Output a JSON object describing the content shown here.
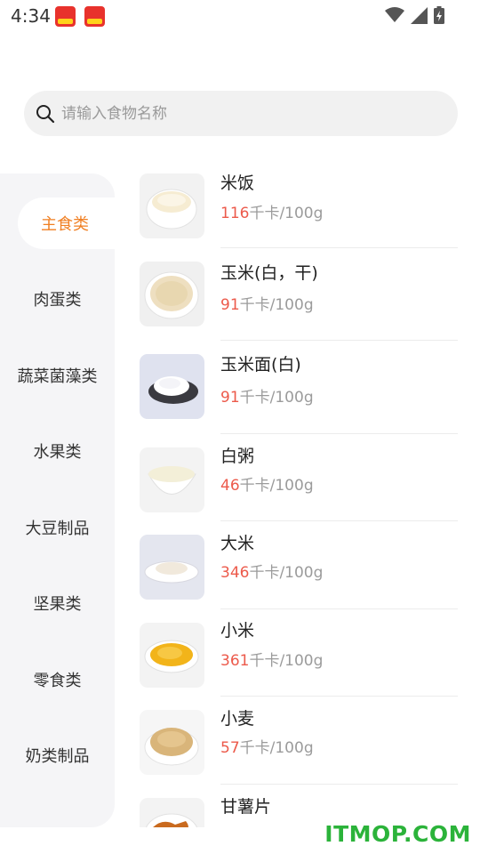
{
  "status_bar": {
    "time": "4:34",
    "icons": [
      "app-badge-icon",
      "app-badge-icon",
      "wifi-icon",
      "signal-icon",
      "battery-charging-icon"
    ]
  },
  "search": {
    "placeholder": "请输入食物名称",
    "icon": "search-icon"
  },
  "sidebar": {
    "items": [
      {
        "label": "主食类",
        "active": true
      },
      {
        "label": "肉蛋类"
      },
      {
        "label": "蔬菜菌藻类"
      },
      {
        "label": "水果类"
      },
      {
        "label": "大豆制品"
      },
      {
        "label": "坚果类"
      },
      {
        "label": "零食类"
      },
      {
        "label": "奶类制品"
      }
    ]
  },
  "foods": {
    "unit": "千卡/100g",
    "items": [
      {
        "name": "米饭",
        "calories": "116"
      },
      {
        "name": "玉米(白，干)",
        "calories": "91"
      },
      {
        "name": "玉米面(白)",
        "calories": "91"
      },
      {
        "name": "白粥",
        "calories": "46"
      },
      {
        "name": "大米",
        "calories": "346"
      },
      {
        "name": "小米",
        "calories": "361"
      },
      {
        "name": "小麦",
        "calories": "57"
      },
      {
        "name": "甘薯片",
        "calories": ""
      }
    ]
  },
  "watermark": "ITMOP.COM",
  "colors": {
    "accent": "#f07f22",
    "calorie_number": "#ec5a4b",
    "sidebar_bg": "#f5f5f7",
    "search_bg": "#f1f1f1",
    "watermark": "#2bb33a"
  }
}
